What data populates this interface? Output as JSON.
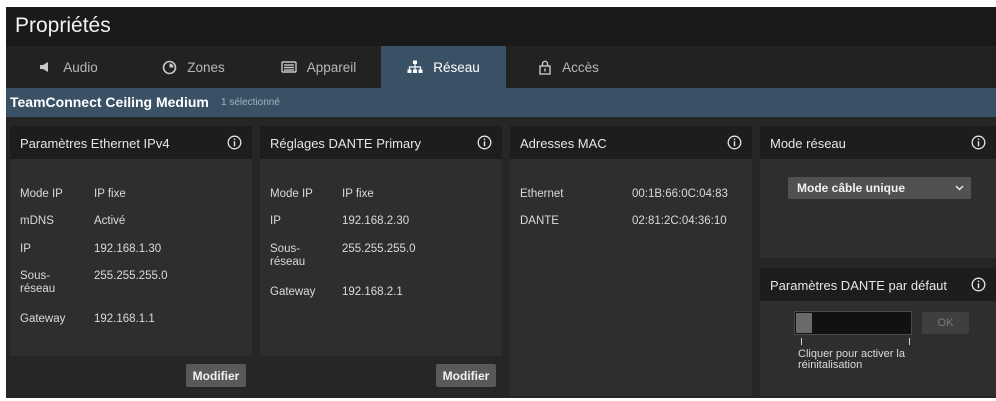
{
  "window": {
    "title": "Propriétés"
  },
  "tabs": [
    {
      "label": "Audio",
      "icon": "speaker-icon"
    },
    {
      "label": "Zones",
      "icon": "zones-icon"
    },
    {
      "label": "Appareil",
      "icon": "device-icon"
    },
    {
      "label": "Réseau",
      "icon": "network-icon",
      "active": true
    },
    {
      "label": "Accès",
      "icon": "lock-icon"
    }
  ],
  "banner": {
    "device_name": "TeamConnect Ceiling Medium",
    "selection": "1 sélectionné"
  },
  "ipv4": {
    "title": "Paramètres Ethernet IPv4",
    "rows": [
      {
        "label": "Mode IP",
        "value": "IP fixe"
      },
      {
        "label": "mDNS",
        "value": "Activé"
      },
      {
        "label": "IP",
        "value": "192.168.1.30"
      },
      {
        "label": "Sous-\nréseau",
        "value": "255.255.255.0"
      },
      {
        "label": "Gateway",
        "value": "192.168.1.1"
      }
    ],
    "button": "Modifier"
  },
  "dante": {
    "title": "Réglages DANTE Primary",
    "rows": [
      {
        "label": "Mode IP",
        "value": "IP fixe"
      },
      {
        "label": "IP",
        "value": "192.168.2.30"
      },
      {
        "label": "Sous-\nréseau",
        "value": "255.255.255.0"
      },
      {
        "label": "Gateway",
        "value": "192.168.2.1"
      }
    ],
    "button": "Modifier"
  },
  "mac": {
    "title": "Adresses MAC",
    "rows": [
      {
        "label": "Ethernet",
        "value": "00:1B:66:0C:04:83"
      },
      {
        "label": "DANTE",
        "value": "02:81:2C:04:36:10"
      }
    ]
  },
  "network_mode": {
    "title": "Mode réseau",
    "selected": "Mode câble unique"
  },
  "dante_default": {
    "title": "Paramètres DANTE par défaut",
    "ok": "OK",
    "hint": "Cliquer pour activer la réinitalisation"
  },
  "colors": {
    "accent": "#3a5165",
    "panel": "#2e2e2e",
    "header": "#1d1d1d"
  }
}
